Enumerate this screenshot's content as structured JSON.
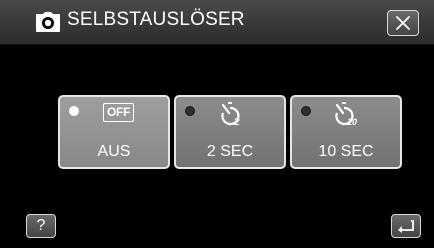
{
  "header": {
    "title": "SELBSTAUSLÖSER",
    "mode_icon": "camera-icon",
    "close_icon": "close-icon"
  },
  "options": [
    {
      "id": "off",
      "label": "AUS",
      "badge": "OFF",
      "selected": true,
      "icon": "off-badge"
    },
    {
      "id": "2sec",
      "label": "2 SEC",
      "selected": false,
      "icon": "self-timer-2-icon",
      "icon_sub": "2"
    },
    {
      "id": "10sec",
      "label": "10 SEC",
      "selected": false,
      "icon": "self-timer-10-icon",
      "icon_sub": "10"
    }
  ],
  "footer": {
    "help_label": "?",
    "back_icon": "return-icon"
  }
}
